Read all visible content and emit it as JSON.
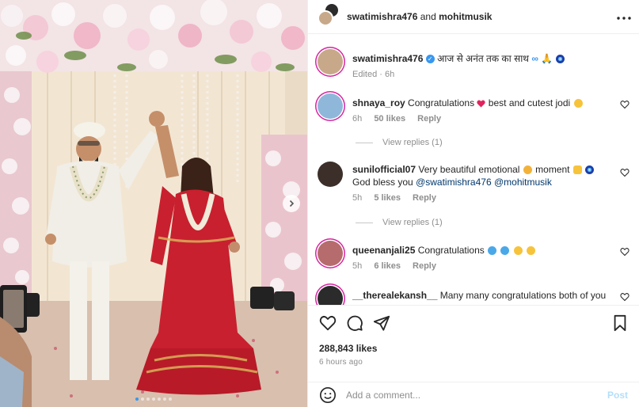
{
  "header": {
    "user1": "swatimishra476",
    "and_text": "and",
    "user2": "mohitmusik"
  },
  "caption": {
    "username": "swatimishra476",
    "text": "आज से अनंत तक का साथ",
    "edited": "Edited · 6h"
  },
  "comments": [
    {
      "username": "shnaya_roy",
      "text_a": "Congratulations",
      "text_b": "best and cutest jodi",
      "time": "6h",
      "likes": "50 likes",
      "reply": "Reply",
      "view_replies": "View replies (1)"
    },
    {
      "username": "sunilofficial07",
      "text_a": "Very beautiful emotional",
      "text_b": "moment",
      "text_c": "God bless you",
      "mention1": "@swatimishra476",
      "mention2": "@mohitmusik",
      "time": "5h",
      "likes": "5 likes",
      "reply": "Reply",
      "view_replies": "View replies (1)"
    },
    {
      "username": "queenanjali25",
      "text_a": "Congratulations",
      "time": "5h",
      "likes": "6 likes",
      "reply": "Reply"
    },
    {
      "username": "__therealekansh__",
      "text_a": "Many many congratulations both of you"
    }
  ],
  "post": {
    "likes": "288,843 likes",
    "time_ago": "6 hours ago"
  },
  "comment_input": {
    "placeholder": "Add a comment...",
    "post_label": "Post"
  },
  "carousel": {
    "slide_count": 7,
    "active_slide": 1
  },
  "colors": {
    "accent_blue": "#0095f6",
    "post_disabled": "#b2dffc",
    "muted_text": "#8e8e8e",
    "mention": "#00376b"
  },
  "icons": [
    "more-icon",
    "heart-icon",
    "comment-icon",
    "share-icon",
    "bookmark-icon",
    "emoji-icon",
    "next-arrow-icon",
    "verified-icon"
  ]
}
